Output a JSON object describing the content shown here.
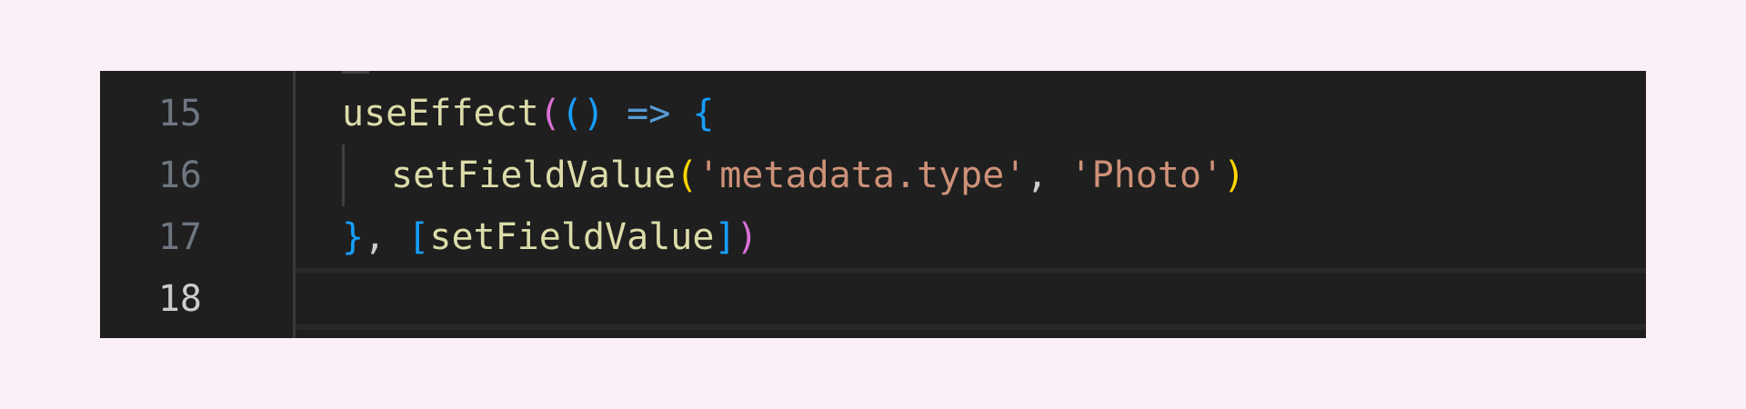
{
  "editor": {
    "current_line": 18,
    "lines": [
      {
        "number": "15",
        "tokens": {
          "fn": "useEffect",
          "open_paren": "(",
          "inner_parens": "()",
          "arrow": "=>",
          "open_brace": "{"
        }
      },
      {
        "number": "16",
        "tokens": {
          "fn": "setFieldValue",
          "open_paren": "(",
          "arg1": "'metadata.type'",
          "comma": ",",
          "arg2": "'Photo'",
          "close_paren": ")"
        }
      },
      {
        "number": "17",
        "tokens": {
          "close_brace": "}",
          "comma": ",",
          "open_bracket": "[",
          "dep": "setFieldValue",
          "close_bracket": "]",
          "close_paren": ")"
        }
      },
      {
        "number": "18",
        "tokens": {}
      }
    ]
  },
  "colors": {
    "background": "#fbf0f8",
    "editor_bg": "#1f1f1f",
    "function": "#dcdcaa",
    "string": "#ce9178",
    "keyword_arrow": "#569cd6",
    "bracket_level1": "#da70d6",
    "bracket_level2": "#179fff",
    "bracket_level3": "#ffd700"
  }
}
